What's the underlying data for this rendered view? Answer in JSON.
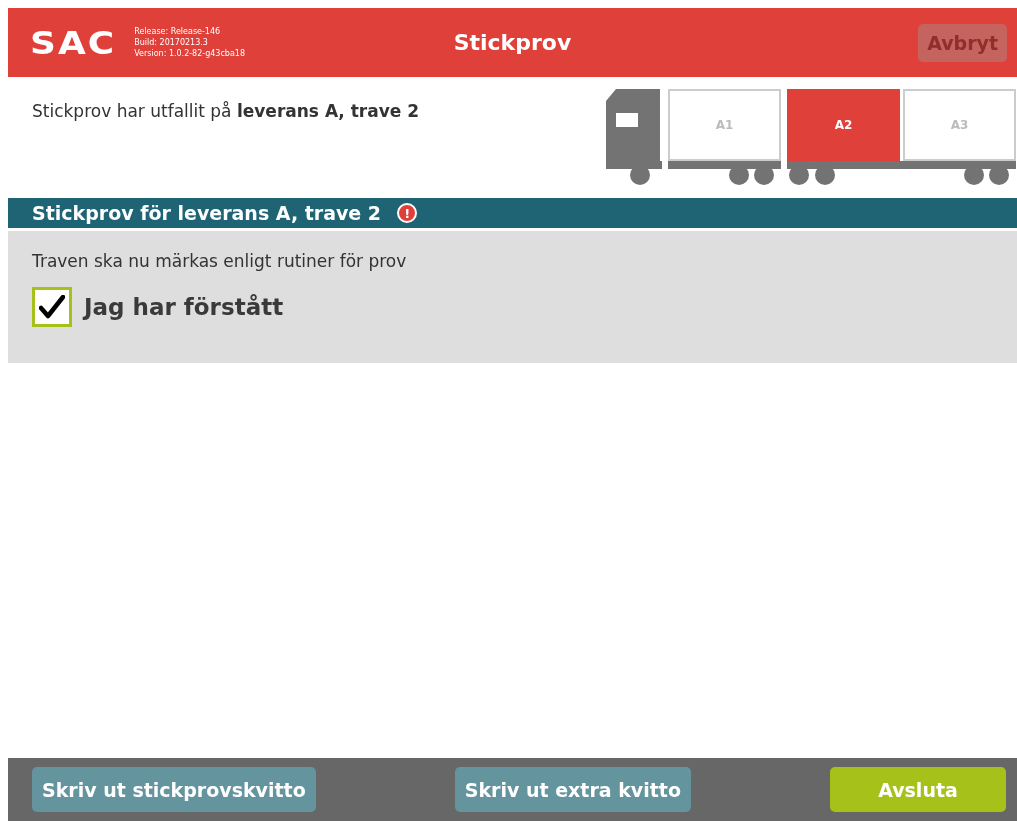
{
  "header": {
    "logo": "SAC",
    "release_info": [
      "Release: Release-146",
      "Build: 20170213.3",
      "Version: 1.0.2-82-g43cba18"
    ],
    "title": "Stickprov",
    "cancel_button": {
      "label": "Avbryt",
      "disabled": true
    }
  },
  "notice": "Stickprov har utfallit på **leverans A, trave 2**",
  "vehicle": {
    "units": [
      {
        "compartments": [
          {
            "label": "A1",
            "selected": false
          }
        ]
      },
      {
        "compartments": [
          {
            "label": "A2",
            "selected": true
          },
          {
            "label": "A3",
            "selected": false
          }
        ]
      }
    ]
  },
  "section": {
    "title": "Stickprov för leverans A, trave 2",
    "alert": "!",
    "instruction": "Traven ska nu märkas enligt rutiner för prov",
    "confirm": {
      "label": "Jag har förstått",
      "checked": true
    }
  },
  "footer": {
    "buttons": [
      {
        "label": "Skriv ut stickprovskvitto",
        "kind": "secondary"
      },
      {
        "label": "Skriv ut extra kvitto",
        "kind": "secondary"
      },
      {
        "label": "Avsluta",
        "kind": "primary"
      }
    ]
  }
}
